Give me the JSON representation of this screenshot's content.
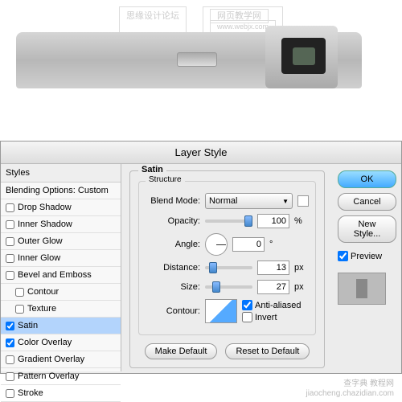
{
  "watermarks": {
    "top1": "思缘设计论坛",
    "top2": "网页教学网",
    "top2_url": "www.webjx.com",
    "bottom1": "查字典 教程网",
    "bottom2": "jiaocheng.chazidian.com"
  },
  "dialog": {
    "title": "Layer Style"
  },
  "styles": {
    "header": "Styles",
    "blending": "Blending Options: Custom",
    "items": [
      {
        "label": "Drop Shadow",
        "checked": false
      },
      {
        "label": "Inner Shadow",
        "checked": false
      },
      {
        "label": "Outer Glow",
        "checked": false
      },
      {
        "label": "Inner Glow",
        "checked": false
      },
      {
        "label": "Bevel and Emboss",
        "checked": false
      },
      {
        "label": "Contour",
        "checked": false,
        "indent": true
      },
      {
        "label": "Texture",
        "checked": false,
        "indent": true
      },
      {
        "label": "Satin",
        "checked": true,
        "selected": true
      },
      {
        "label": "Color Overlay",
        "checked": true
      },
      {
        "label": "Gradient Overlay",
        "checked": false
      },
      {
        "label": "Pattern Overlay",
        "checked": false
      },
      {
        "label": "Stroke",
        "checked": false
      }
    ]
  },
  "satin": {
    "group": "Satin",
    "structure": "Structure",
    "blend_mode_label": "Blend Mode:",
    "blend_mode_value": "Normal",
    "opacity_label": "Opacity:",
    "opacity_value": "100",
    "opacity_unit": "%",
    "angle_label": "Angle:",
    "angle_value": "0",
    "angle_unit": "°",
    "distance_label": "Distance:",
    "distance_value": "13",
    "distance_unit": "px",
    "size_label": "Size:",
    "size_value": "27",
    "size_unit": "px",
    "contour_label": "Contour:",
    "anti_aliased": "Anti-aliased",
    "invert": "Invert",
    "make_default": "Make Default",
    "reset_default": "Reset to Default"
  },
  "buttons": {
    "ok": "OK",
    "cancel": "Cancel",
    "new_style": "New Style...",
    "preview": "Preview"
  }
}
